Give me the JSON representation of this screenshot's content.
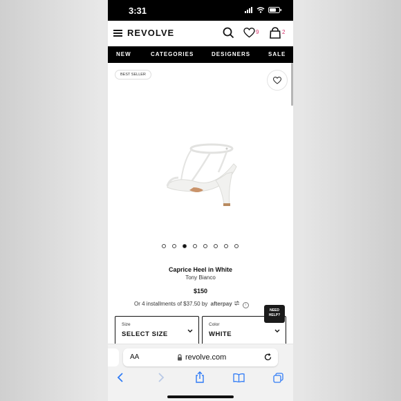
{
  "status": {
    "time": "3:31"
  },
  "header": {
    "brand": "REVOLVE",
    "wishlist_count": "9",
    "bag_count": "2"
  },
  "nav": {
    "items": [
      "NEW",
      "CATEGORIES",
      "DESIGNERS",
      "SALE"
    ]
  },
  "product": {
    "badge": "BEST SELLER",
    "name": "Caprice Heel in White",
    "brand": "Tony Bianco",
    "price": "$150",
    "installments_text": "Or 4 installments of $37.50 by",
    "afterpay": "afterpay",
    "image_count": 8,
    "active_image": 2
  },
  "selectors": {
    "size": {
      "label": "Size",
      "value": "SELECT SIZE"
    },
    "color": {
      "label": "Color",
      "value": "WHITE"
    }
  },
  "help": {
    "line1": "NEED",
    "line2": "HELP?"
  },
  "browser": {
    "text_size": "AA",
    "url": "revolve.com"
  },
  "colors": {
    "brand_black": "#000000",
    "accent_pink": "#d6336c"
  }
}
